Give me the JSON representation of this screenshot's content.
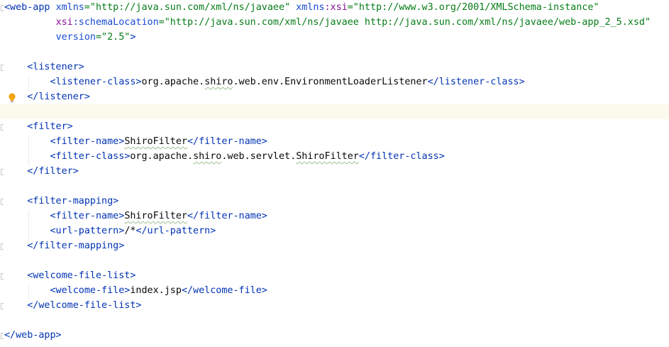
{
  "editor": {
    "lines": [
      [
        [
          "tag",
          "<web-app "
        ],
        [
          "attr",
          "xmlns"
        ],
        [
          "val",
          "=\"http://java.sun.com/xml/ns/javaee\" "
        ],
        [
          "attr",
          "xmlns"
        ],
        [
          "ns",
          ":xsi"
        ],
        [
          "val",
          "=\"http://www.w3.org/2001/XMLSchema-instance\""
        ]
      ],
      [
        [
          "txt",
          "         "
        ],
        [
          "ns",
          "xsi"
        ],
        [
          "attr",
          ":schemaLocation"
        ],
        [
          "val",
          "=\"http://java.sun.com/xml/ns/javaee http://java.sun.com/xml/ns/javaee/web-app_2_5.xsd\""
        ]
      ],
      [
        [
          "txt",
          "         "
        ],
        [
          "attr",
          "version"
        ],
        [
          "val",
          "=\"2.5\""
        ],
        [
          "tag",
          ">"
        ]
      ],
      [],
      [
        [
          "txt",
          "    "
        ],
        [
          "tag",
          "<listener>"
        ]
      ],
      [
        [
          "txt",
          "        "
        ],
        [
          "tag",
          "<listener-class>"
        ],
        [
          "txt",
          "org.apache."
        ],
        [
          "spell",
          "shiro"
        ],
        [
          "txt",
          ".web.env.EnvironmentLoaderListener"
        ],
        [
          "tag",
          "</listener-class>"
        ]
      ],
      [
        [
          "txt",
          "    "
        ],
        [
          "tag",
          "</listener>"
        ]
      ],
      [],
      [
        [
          "txt",
          "    "
        ],
        [
          "tag",
          "<filter>"
        ]
      ],
      [
        [
          "txt",
          "        "
        ],
        [
          "tag",
          "<filter-name>"
        ],
        [
          "spell",
          "ShiroFilter"
        ],
        [
          "tag",
          "</filter-name>"
        ]
      ],
      [
        [
          "txt",
          "        "
        ],
        [
          "tag",
          "<filter-class>"
        ],
        [
          "txt",
          "org.apache."
        ],
        [
          "spell",
          "shiro"
        ],
        [
          "txt",
          ".web.servlet."
        ],
        [
          "spell",
          "ShiroFilter"
        ],
        [
          "tag",
          "</filter-class>"
        ]
      ],
      [
        [
          "txt",
          "    "
        ],
        [
          "tag",
          "</filter>"
        ]
      ],
      [],
      [
        [
          "txt",
          "    "
        ],
        [
          "tag",
          "<filter-mapping>"
        ]
      ],
      [
        [
          "txt",
          "        "
        ],
        [
          "tag",
          "<filter-name>"
        ],
        [
          "spell",
          "ShiroFilter"
        ],
        [
          "tag",
          "</filter-name>"
        ]
      ],
      [
        [
          "txt",
          "        "
        ],
        [
          "tag",
          "<url-pattern>"
        ],
        [
          "txt",
          "/*"
        ],
        [
          "tag",
          "</url-pattern>"
        ]
      ],
      [
        [
          "txt",
          "    "
        ],
        [
          "tag",
          "</filter-mapping>"
        ]
      ],
      [],
      [
        [
          "txt",
          "    "
        ],
        [
          "tag",
          "<welcome-file-list>"
        ]
      ],
      [
        [
          "txt",
          "        "
        ],
        [
          "tag",
          "<welcome-file>"
        ],
        [
          "txt",
          "index.jsp"
        ],
        [
          "tag",
          "</welcome-file>"
        ]
      ],
      [
        [
          "txt",
          "    "
        ],
        [
          "tag",
          "</welcome-file-list>"
        ]
      ],
      [],
      [
        [
          "tag",
          "</web-app>"
        ]
      ]
    ],
    "current_line": 7,
    "colors": {
      "tag": "#0033b3",
      "attribute": "#174ad4",
      "namespace": "#871094",
      "value": "#067d17",
      "text": "#080808",
      "current_line_bg": "#fcfaed",
      "bulb": "#f2a50c"
    },
    "gutter_icons": [
      "intention-bulb-icon"
    ]
  }
}
